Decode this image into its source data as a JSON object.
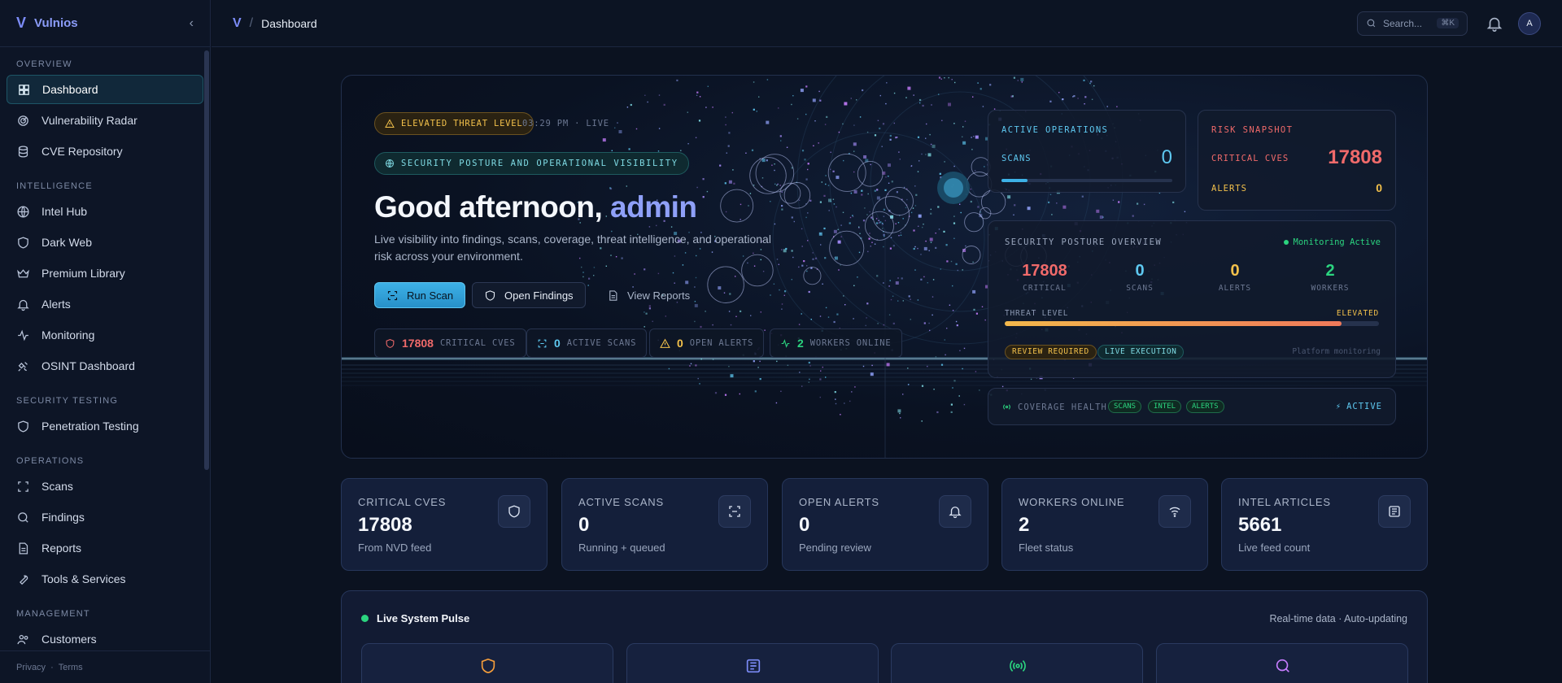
{
  "sidebar": {
    "brand": "Vulnios",
    "sections": [
      {
        "title": "OVERVIEW",
        "items": [
          {
            "label": "Dashboard",
            "icon": "grid-icon",
            "active": true
          },
          {
            "label": "Vulnerability Radar",
            "icon": "radar-icon"
          },
          {
            "label": "CVE Repository",
            "icon": "database-icon"
          }
        ]
      },
      {
        "title": "INTELLIGENCE",
        "items": [
          {
            "label": "Intel Hub",
            "icon": "globe-icon"
          },
          {
            "label": "Dark Web",
            "icon": "shield-icon"
          },
          {
            "label": "Premium Library",
            "icon": "crown-icon"
          },
          {
            "label": "Alerts",
            "icon": "bell-icon"
          },
          {
            "label": "Monitoring",
            "icon": "activity-icon"
          },
          {
            "label": "OSINT Dashboard",
            "icon": "satellite-icon"
          }
        ]
      },
      {
        "title": "SECURITY TESTING",
        "items": [
          {
            "label": "Penetration Testing",
            "icon": "shield-icon"
          }
        ]
      },
      {
        "title": "OPERATIONS",
        "items": [
          {
            "label": "Scans",
            "icon": "scan-icon"
          },
          {
            "label": "Findings",
            "icon": "search-icon"
          },
          {
            "label": "Reports",
            "icon": "file-icon"
          },
          {
            "label": "Tools & Services",
            "icon": "wrench-icon"
          }
        ]
      },
      {
        "title": "MANAGEMENT",
        "items": [
          {
            "label": "Customers",
            "icon": "users-icon"
          }
        ]
      }
    ],
    "footer": {
      "privacy": "Privacy",
      "sep": "·",
      "terms": "Terms"
    }
  },
  "topbar": {
    "breadcrumb_sep": "/",
    "title": "Dashboard",
    "search_placeholder": "Search...",
    "search_shortcut": "⌘K",
    "avatar": "A"
  },
  "hero": {
    "threat_pill": "ELEVATED THREAT LEVEL",
    "time": "03:29 PM · LIVE",
    "posture_pill": "SECURITY POSTURE AND OPERATIONAL VISIBILITY",
    "greeting": "Good afternoon, ",
    "username": "admin",
    "subtitle": "Live visibility into findings, scans, coverage, threat intelligence, and operational risk across your environment.",
    "btn_run": "Run Scan",
    "btn_findings": "Open Findings",
    "btn_reports": "View Reports",
    "chips": [
      {
        "value": "17808",
        "label": "CRITICAL CVES",
        "color": "#f06a6a"
      },
      {
        "value": "0",
        "label": "ACTIVE SCANS",
        "color": "#5ec8f0"
      },
      {
        "value": "0",
        "label": "OPEN ALERTS",
        "color": "#f3c14b"
      },
      {
        "value": "2",
        "label": "WORKERS ONLINE",
        "color": "#2bd47f"
      }
    ],
    "active_ops": {
      "title": "ACTIVE OPERATIONS",
      "scans_label": "SCANS",
      "scans_value": "0",
      "progress": 0.15
    },
    "risk": {
      "title": "RISK SNAPSHOT",
      "critical_label": "CRITICAL CVES",
      "critical_value": "17808",
      "alerts_label": "ALERTS",
      "alerts_value": "0"
    },
    "posture": {
      "title": "SECURITY POSTURE OVERVIEW",
      "status": "Monitoring Active",
      "stats": [
        {
          "value": "17808",
          "label": "CRITICAL",
          "color": "#f06a6a"
        },
        {
          "value": "0",
          "label": "SCANS",
          "color": "#5ec8f0"
        },
        {
          "value": "0",
          "label": "ALERTS",
          "color": "#f3c14b"
        },
        {
          "value": "2",
          "label": "WORKERS",
          "color": "#2bd47f"
        }
      ],
      "threat_label": "THREAT LEVEL",
      "threat_value": "ELEVATED",
      "threat_fill": 0.9,
      "tag_review": "REVIEW REQUIRED",
      "tag_live": "LIVE EXECUTION",
      "platform": "Platform monitoring"
    },
    "coverage": {
      "label": "COVERAGE HEALTH",
      "tags": [
        "SCANS",
        "INTEL",
        "ALERTS"
      ],
      "status": "ACTIVE"
    }
  },
  "kpis": [
    {
      "label": "CRITICAL CVES",
      "value": "17808",
      "note": "From NVD feed",
      "icon": "shield-icon"
    },
    {
      "label": "ACTIVE SCANS",
      "value": "0",
      "note": "Running + queued",
      "icon": "scan-icon"
    },
    {
      "label": "OPEN ALERTS",
      "value": "0",
      "note": "Pending review",
      "icon": "bell-icon"
    },
    {
      "label": "WORKERS ONLINE",
      "value": "2",
      "note": "Fleet status",
      "icon": "wifi-icon"
    },
    {
      "label": "INTEL ARTICLES",
      "value": "5661",
      "note": "Live feed count",
      "icon": "newspaper-icon"
    }
  ],
  "pulse": {
    "title": "Live System Pulse",
    "right": "Real-time data · Auto-updating",
    "cards": [
      {
        "icon": "shield-icon",
        "color": "#f59e3b"
      },
      {
        "icon": "newspaper-icon",
        "color": "#7c8cf8"
      },
      {
        "icon": "broadcast-icon",
        "color": "#2bd47f"
      },
      {
        "icon": "search-icon",
        "color": "#c77dff"
      }
    ]
  }
}
